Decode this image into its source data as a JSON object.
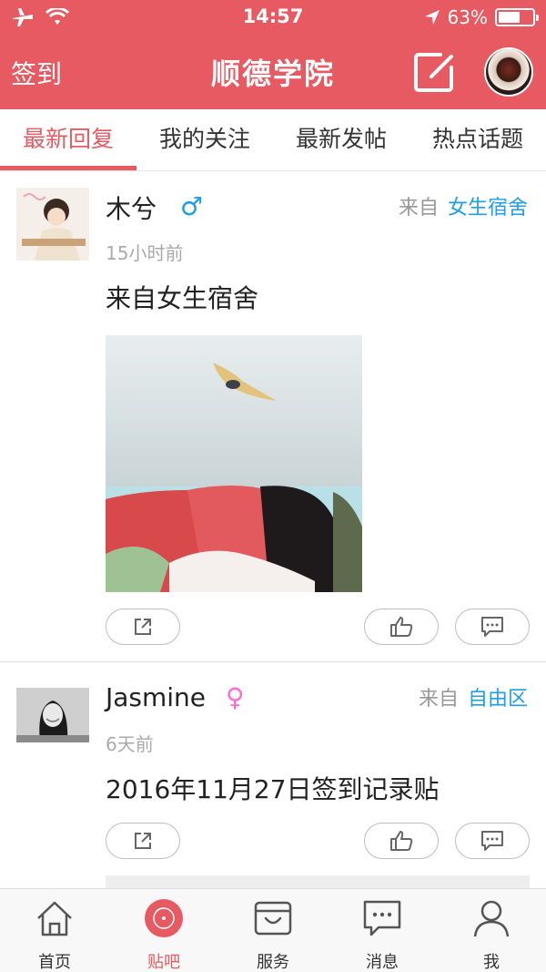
{
  "status_bar": {
    "time": "14:57",
    "battery": "63%",
    "battery_level": 0.63
  },
  "header": {
    "checkin_label": "签到",
    "title": "顺德学院",
    "compose_icon": "compose-icon",
    "avatar": "user-avatar"
  },
  "tabs": [
    {
      "label": "最新回复",
      "active": true
    },
    {
      "label": "我的关注",
      "active": false
    },
    {
      "label": "最新发帖",
      "active": false
    },
    {
      "label": "热点话题",
      "active": false
    }
  ],
  "posts": [
    {
      "author": "木兮",
      "gender_symbol": "♂",
      "gender_color": "#1e9ee8",
      "from_label": "来自",
      "board": "女生宿舍",
      "time": "15小时前",
      "content": "来自女生宿舍"
    },
    {
      "author": "Jasmine",
      "gender_symbol": "♀",
      "gender_color": "#ff6ad5",
      "from_label": "来自",
      "board": "自由区",
      "time": "6天前",
      "content": "2016年11月27日签到记录贴"
    }
  ],
  "tabbar": [
    {
      "label": "首页",
      "icon": "home-icon",
      "active": false
    },
    {
      "label": "贴吧",
      "icon": "record-icon",
      "active": true
    },
    {
      "label": "服务",
      "icon": "service-icon",
      "active": false
    },
    {
      "label": "消息",
      "icon": "message-icon",
      "active": false
    },
    {
      "label": "我",
      "icon": "person-icon",
      "active": false
    }
  ],
  "colors": {
    "brand": "#e75a61",
    "link": "#1e9ee8",
    "muted": "#999999"
  }
}
